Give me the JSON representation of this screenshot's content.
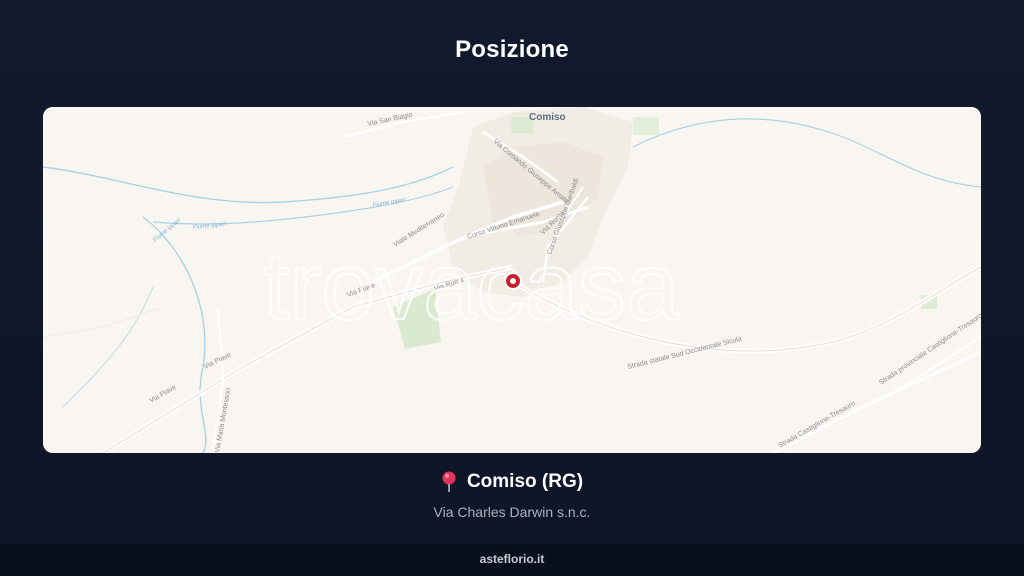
{
  "header": {
    "title": "Posizione"
  },
  "map": {
    "city_label": "Comiso",
    "watermark": "trovacasa",
    "marker_icon": "map-marker-icon",
    "streets": [
      "Via San Biagio",
      "Viale Mediterraneo",
      "Corso Vittorio Emanuele",
      "Via Roma",
      "Corso Giuseppe Garibaldi",
      "Via Comando Giuseppe Amato",
      "Via Piave",
      "Via Roma",
      "Via Piave",
      "Via Piave",
      "Via Maria Montessori",
      "Strada statale Sud Occidentale Sicula",
      "Strada provinciale Castiglione-Tresauro",
      "Strada Castiglione-Tresauro"
    ],
    "rivers": [
      "Fiume Ippari",
      "Fiume Ippari",
      "Fiume Ippari"
    ]
  },
  "location": {
    "pin_icon": "pin-icon",
    "city": "Comiso (RG)",
    "address": "Via Charles Darwin s.n.c."
  },
  "footer": {
    "site": "asteflorio.it"
  }
}
